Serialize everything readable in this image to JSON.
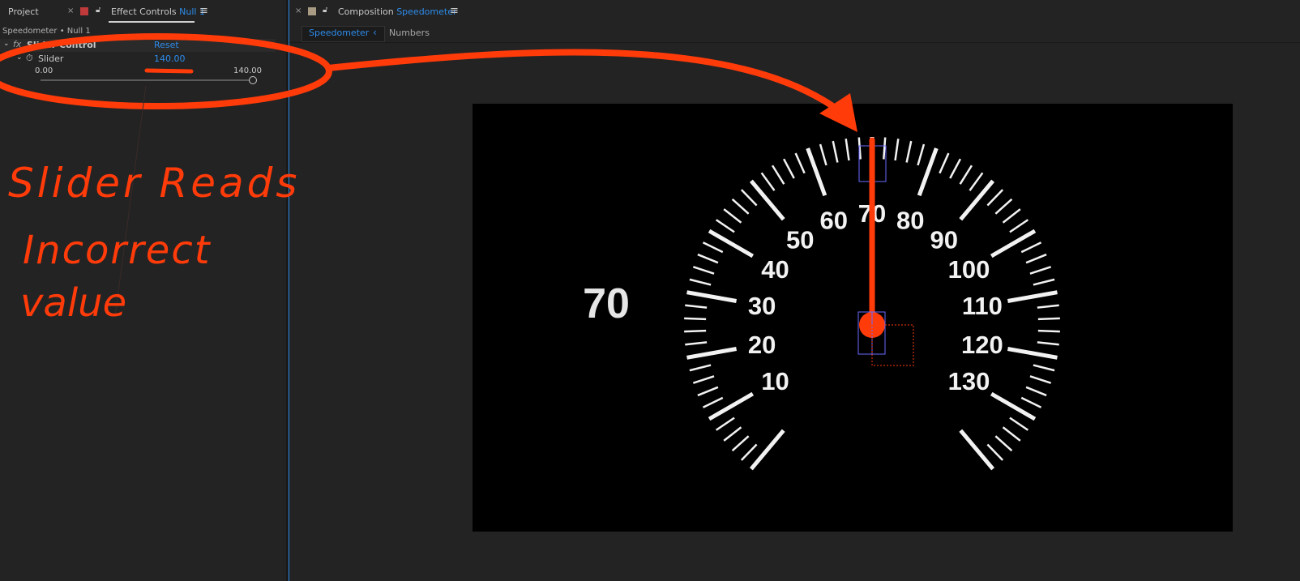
{
  "left_panel": {
    "tabs": {
      "project": "Project",
      "close_glyph": "×",
      "effect_controls": "Effect Controls",
      "layer_name": "Null 1",
      "menu_glyph": "≡"
    },
    "breadcrumb": "Speedometer • Null 1",
    "effect": {
      "name": "Slider Control",
      "reset_label": "Reset",
      "property_name": "Slider",
      "value": "140.00",
      "range_min": "0.00",
      "range_max": "140.00",
      "slider_level_percent": 100
    }
  },
  "right_panel": {
    "tabs": {
      "close_glyph": "×",
      "composition": "Composition",
      "comp_name": "Speedometer",
      "menu_glyph": "≡"
    },
    "subtabs": {
      "active": "Speedometer",
      "chevron": "‹",
      "other": "Numbers"
    },
    "viewer": {
      "readout": "70",
      "needle_value": 70,
      "gauge_min": 0,
      "gauge_max": 140,
      "gauge_labels": [
        "10",
        "20",
        "30",
        "40",
        "50",
        "60",
        "70",
        "80",
        "90",
        "100",
        "110",
        "120",
        "130"
      ]
    }
  },
  "annotation": {
    "line1": "Slider Reads",
    "line2": "Incorrect",
    "line3": "value",
    "color": "#ff3b0a"
  },
  "colors": {
    "accent": "#2d8ceb",
    "panel_bg": "#232323",
    "needle": "#ff3b0a"
  }
}
